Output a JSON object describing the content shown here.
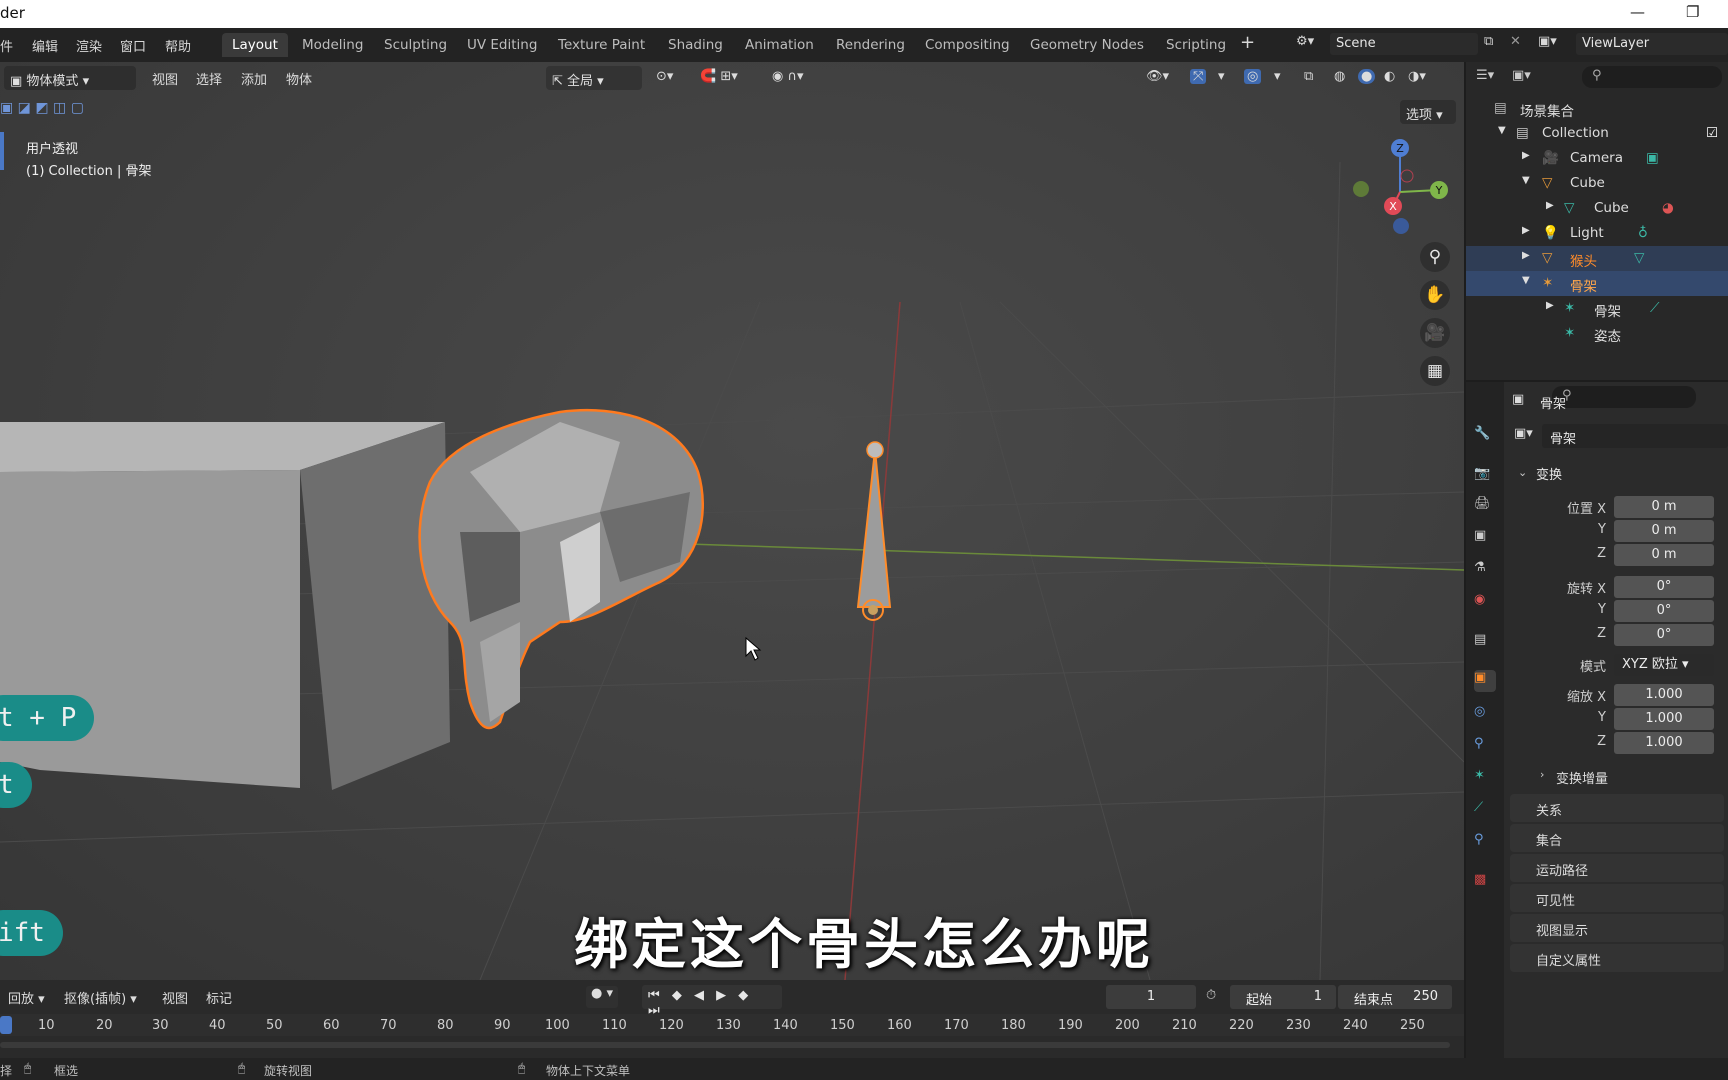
{
  "window": {
    "title": "der"
  },
  "menu": [
    "件",
    "编辑",
    "渲染",
    "窗口",
    "帮助"
  ],
  "workspaces": [
    "Layout",
    "Modeling",
    "Sculpting",
    "UV Editing",
    "Texture Paint",
    "Shading",
    "Animation",
    "Rendering",
    "Compositing",
    "Geometry Nodes",
    "Scripting"
  ],
  "scene": {
    "name": "Scene",
    "viewlayer": "ViewLayer"
  },
  "viewport": {
    "mode": "物体模式",
    "menus": [
      "视图",
      "选择",
      "添加",
      "物体"
    ],
    "transform_orient": "全局",
    "options": "选项",
    "view_label": "用户透视",
    "collection_label": "(1) Collection | 骨架",
    "gizmo": {
      "z": "Z",
      "x": "X",
      "y": "Y"
    },
    "keys": [
      "t + P",
      "t",
      "ift"
    ],
    "subtitle": "绑定这个骨头怎么办呢"
  },
  "outliner": {
    "root": "场景集合",
    "rows": [
      "Collection",
      "Camera",
      "Cube",
      "Cube",
      "Light",
      "猴头",
      "骨架",
      "骨架",
      "姿态"
    ]
  },
  "properties": {
    "object_name": "骨架",
    "data_name": "骨架",
    "transform": "变换",
    "location_label": "位置 X",
    "rotation_label": "旋转 X",
    "scale_label": "缩放 X",
    "axis_y": "Y",
    "axis_z": "Z",
    "mode_label": "模式",
    "mode_value": "XYZ 欧拉",
    "loc": [
      "0 m",
      "0 m",
      "0 m"
    ],
    "rot": [
      "0°",
      "0°",
      "0°"
    ],
    "scale": [
      "1.000",
      "1.000",
      "1.000"
    ],
    "delta": "变换增量",
    "sections": [
      "关系",
      "集合",
      "运动路径",
      "可见性",
      "视图显示",
      "自定义属性"
    ]
  },
  "timeline": {
    "menus": [
      "回放",
      "抠像(插帧)",
      "视图",
      "标记"
    ],
    "current": "1",
    "start_label": "起始",
    "start": "1",
    "end_label": "结束点",
    "end": "250",
    "ticks": [
      "10",
      "20",
      "30",
      "40",
      "50",
      "60",
      "70",
      "80",
      "90",
      "100",
      "110",
      "120",
      "130",
      "140",
      "150",
      "160",
      "170",
      "180",
      "190",
      "200",
      "210",
      "220",
      "230",
      "240",
      "250"
    ]
  },
  "status": {
    "left": "择",
    "select": "框选",
    "rotate": "旋转视图",
    "context": "物体上下文菜单"
  }
}
